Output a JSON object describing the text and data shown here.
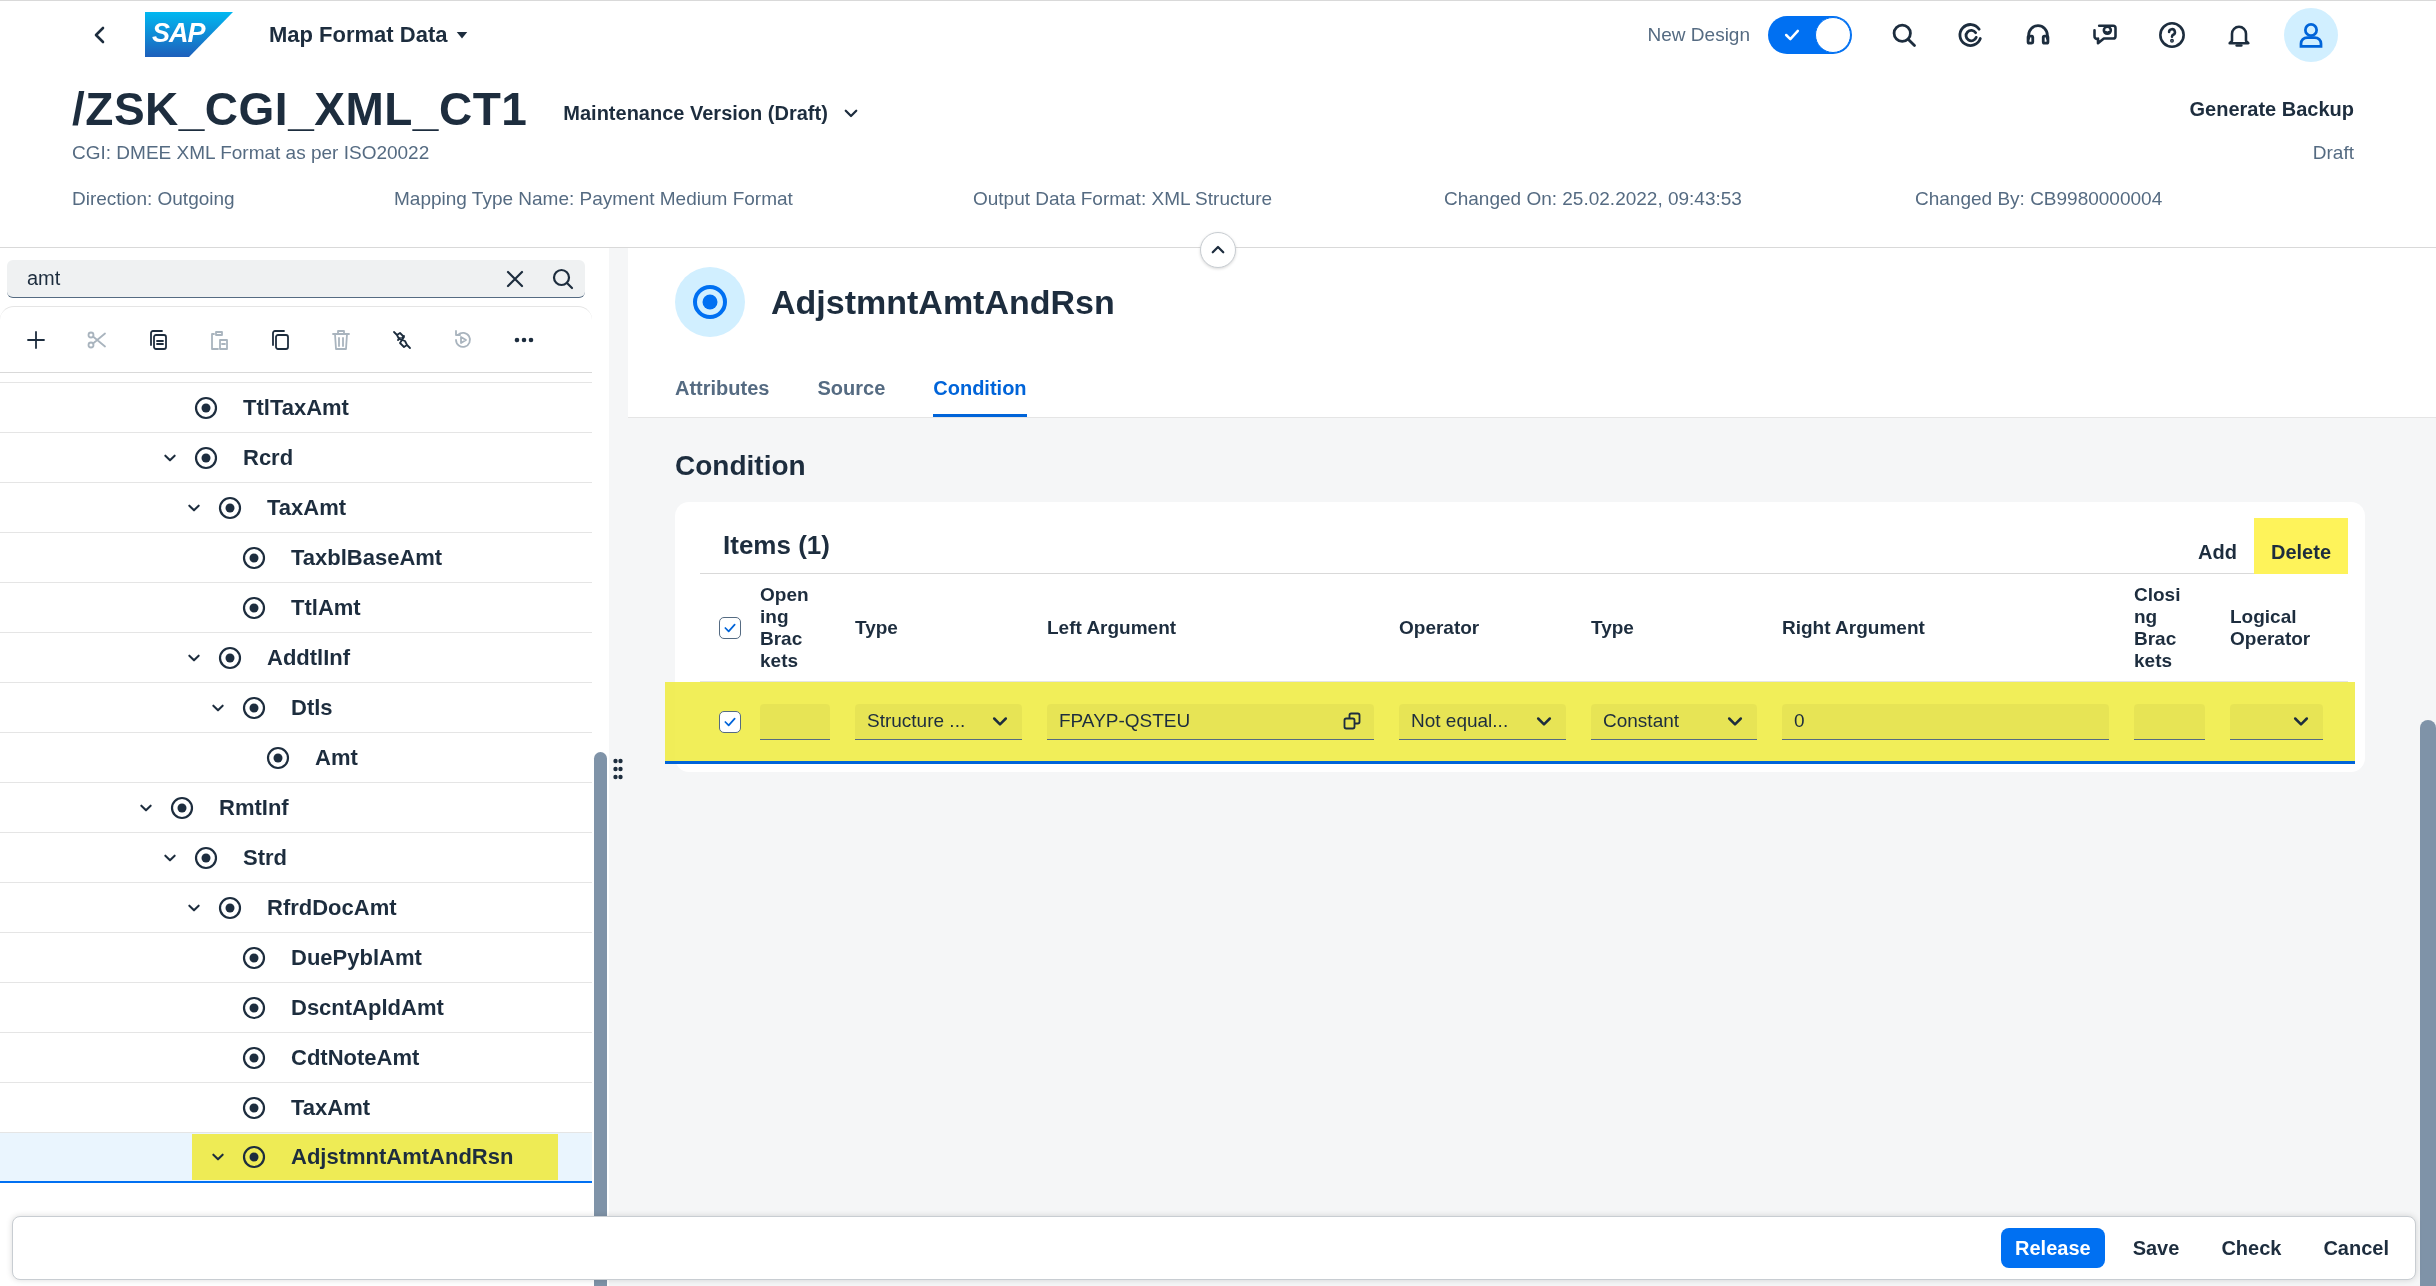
{
  "shell": {
    "logo": "SAP",
    "title": "Map Format Data",
    "toggle": {
      "label": "New Design",
      "on": true
    }
  },
  "header": {
    "title": "/ZSK_CGI_XML_CT1",
    "version": "Maintenance Version (Draft)",
    "subtitle": "CGI: DMEE XML Format as per ISO20022",
    "action": "Generate Backup",
    "status": "Draft",
    "attributes": [
      "Direction: Outgoing",
      "Mapping Type Name: Payment Medium Format",
      "Output Data Format: XML Structure",
      "Changed On: 25.02.2022, 09:43:53",
      "Changed By: CB9980000004"
    ]
  },
  "tree": {
    "search": {
      "value": "amt"
    },
    "toolbar": [
      {
        "kind": "add",
        "disabled": false
      },
      {
        "kind": "cut",
        "disabled": true
      },
      {
        "kind": "copy",
        "disabled": false
      },
      {
        "kind": "paste",
        "disabled": true
      },
      {
        "kind": "duplicate",
        "disabled": false
      },
      {
        "kind": "delete",
        "disabled": true
      },
      {
        "kind": "unlink",
        "disabled": false
      },
      {
        "kind": "reset",
        "disabled": true
      },
      {
        "kind": "more",
        "disabled": false
      }
    ],
    "branch_above": [
      {
        "label": "TtlTaxAmt",
        "selected": false,
        "highlighted": false
      },
      {
        "label": "Rcrd",
        "expanded": true,
        "selected": false,
        "highlighted": false,
        "children": [
          {
            "label": "TaxAmt",
            "expanded": true,
            "selected": false,
            "highlighted": false,
            "children": [
              {
                "label": "TaxblBaseAmt",
                "selected": false,
                "highlighted": false
              },
              {
                "label": "TtlAmt",
                "selected": false,
                "highlighted": false
              }
            ]
          },
          {
            "label": "AddtlInf",
            "expanded": true,
            "selected": false,
            "highlighted": false,
            "children": [
              {
                "label": "Dtls",
                "expanded": true,
                "selected": false,
                "highlighted": false,
                "children": [
                  {
                    "label": "Amt",
                    "selected": false,
                    "highlighted": false
                  }
                ]
              }
            ]
          }
        ]
      }
    ],
    "items": [
      {
        "label": "RmtInf",
        "expanded": true,
        "selected": false,
        "highlighted": false,
        "children": [
          {
            "label": "Strd",
            "expanded": true,
            "selected": false,
            "highlighted": false,
            "children": [
              {
                "label": "RfrdDocAmt",
                "expanded": true,
                "selected": false,
                "highlighted": false,
                "children": [
                  {
                    "label": "DuePyblAmt",
                    "selected": false,
                    "highlighted": false
                  },
                  {
                    "label": "DscntApldAmt",
                    "selected": false,
                    "highlighted": false
                  },
                  {
                    "label": "CdtNoteAmt",
                    "selected": false,
                    "highlighted": false
                  },
                  {
                    "label": "TaxAmt",
                    "selected": false,
                    "highlighted": false
                  },
                  {
                    "label": "AdjstmntAmtAndRsn",
                    "expanded": true,
                    "selected": true,
                    "highlighted": true
                  }
                ]
              }
            ]
          }
        ]
      }
    ]
  },
  "detail": {
    "title": "AdjstmntAmtAndRsn",
    "tabs": [
      {
        "label": "Attributes",
        "selected": false
      },
      {
        "label": "Source",
        "selected": false
      },
      {
        "label": "Condition",
        "selected": true
      }
    ],
    "section_title": "Condition",
    "table": {
      "title": "Items (1)",
      "actions": [
        {
          "label": "Add",
          "highlighted": false
        },
        {
          "label": "Delete",
          "highlighted": true
        }
      ],
      "select_all": true,
      "columns": [
        "Opening Brackets",
        "Type",
        "Left Argument",
        "Operator",
        "Type",
        "Right Argument",
        "Closing Brackets",
        "Logical Operator"
      ],
      "rows": [
        {
          "checked": true,
          "selected": true,
          "highlighted": true,
          "cells": [
            {
              "kind": "input"
            },
            {
              "kind": "select",
              "value": "Structure ..."
            },
            {
              "kind": "value-help",
              "value": "FPAYP-QSTEU"
            },
            {
              "kind": "select",
              "value": "Not equal..."
            },
            {
              "kind": "select",
              "value": "Constant"
            },
            {
              "kind": "input",
              "value": "0"
            },
            {
              "kind": "input"
            },
            {
              "kind": "select"
            }
          ]
        }
      ]
    }
  },
  "footer": {
    "buttons": [
      {
        "label": "Release",
        "kind": "emphasized"
      },
      {
        "label": "Save",
        "kind": "transparent"
      },
      {
        "label": "Check",
        "kind": "transparent"
      },
      {
        "label": "Cancel",
        "kind": "transparent"
      }
    ]
  }
}
